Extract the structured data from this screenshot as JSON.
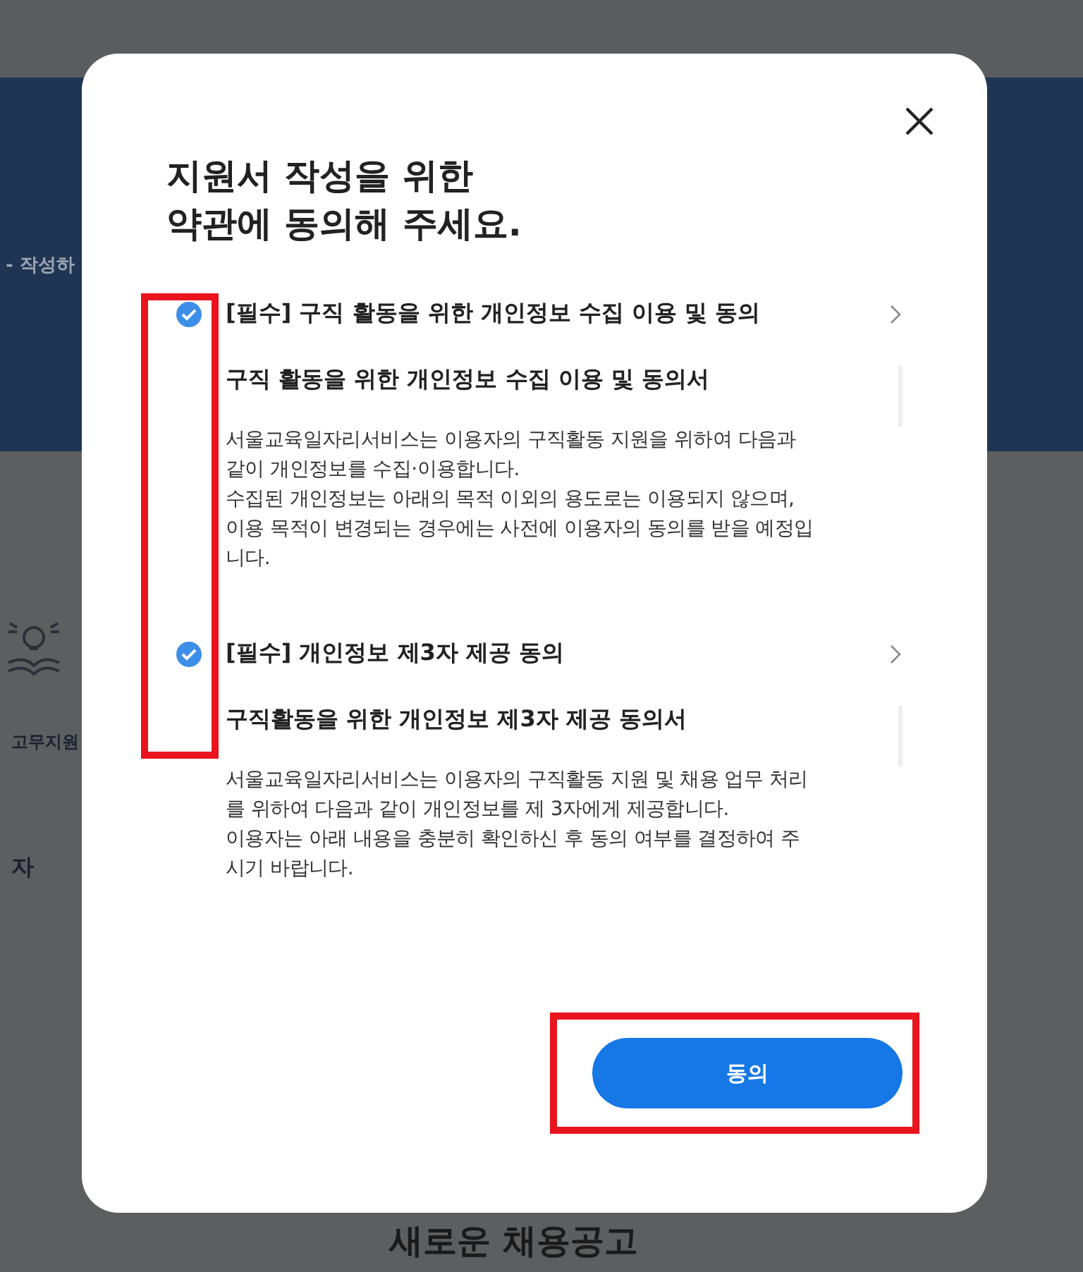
{
  "background": {
    "side_fragments": [
      "- 작성하",
      "고무지원",
      "자"
    ],
    "section_title": "새로운 채용공고"
  },
  "dialog": {
    "title_lines": [
      "지원서 작성을 위한",
      "약관에 동의해 주세요."
    ],
    "terms": [
      {
        "label": "[필수] 구직 활동을 위한 개인정보 수집 이용 및 동의",
        "checked": true,
        "heading": "구직 활동을 위한 개인정보 수집 이용 및 동의서",
        "paragraphs": [
          "서울교육일자리서비스는 이용자의 구직활동 지원을 위하여 다음과 같이 개인정보를 수집·이용합니다.",
          "수집된 개인정보는 아래의 목적 이외의 용도로는 이용되지 않으며, 이용 목적이 변경되는 경우에는 사전에 이용자의 동의를 받을 예정입니다."
        ]
      },
      {
        "label": "[필수] 개인정보 제3자 제공 동의",
        "checked": true,
        "heading": "구직활동을 위한 개인정보 제3자 제공 동의서",
        "paragraphs": [
          "서울교육일자리서비스는 이용자의 구직활동 지원 및 채용 업무 처리를 위하여 다음과 같이 개인정보를 제 3자에게 제공합니다.",
          "이용자는 아래 내용을 충분히 확인하신 후 동의 여부를 결정하여 주시기 바랍니다."
        ]
      }
    ],
    "agree_button": "동의"
  }
}
